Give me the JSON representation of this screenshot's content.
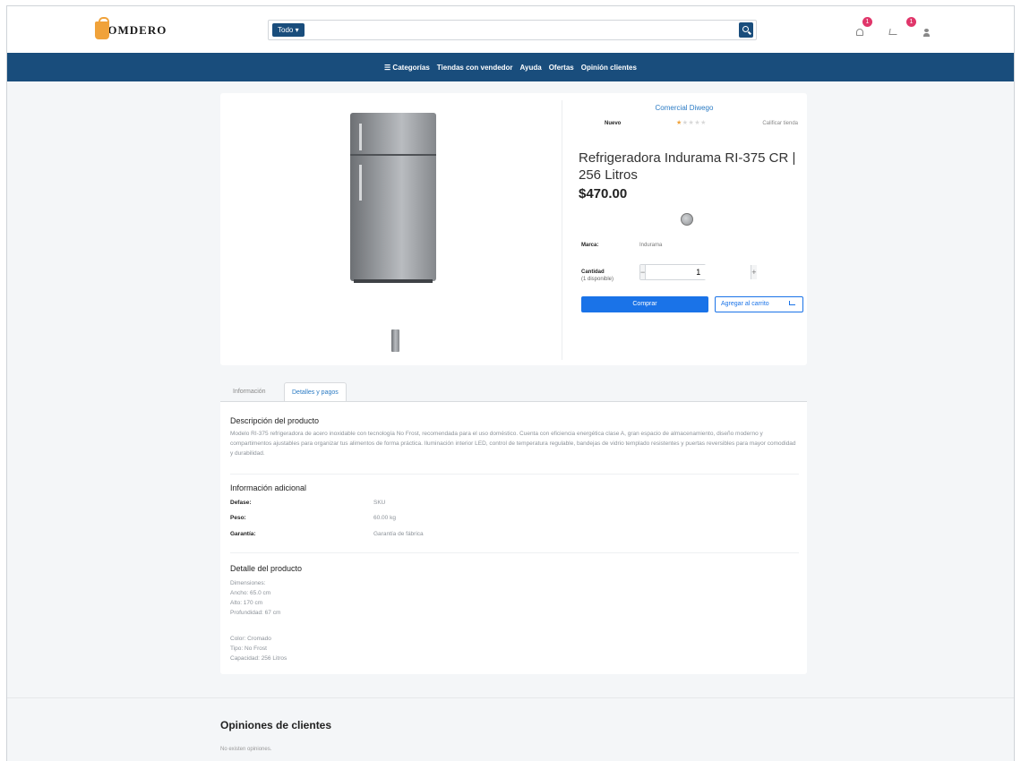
{
  "header": {
    "logo_text": "COMDERO",
    "search": {
      "category_label": "Todo ▾",
      "placeholder": ""
    },
    "notifications_count": "1",
    "cart_count": "1"
  },
  "nav": {
    "items": [
      "☰ Categorías",
      "Tiendas con vendedor",
      "Ayuda",
      "Ofertas",
      "Opinión clientes"
    ]
  },
  "product": {
    "seller": "Comercial Diwego",
    "condition": "Nuevo",
    "rating_stars": 1,
    "review_link": "Calificar tienda",
    "title": "Refrigeradora Indurama RI-375 CR | 256 Litros",
    "price": "$470.00",
    "brand_label": "Marca:",
    "brand_value": "Indurama",
    "quantity_label": "Cantidad",
    "quantity_stock": "(1 disponible)",
    "quantity_value": "1",
    "buy_label": "Comprar",
    "add_cart_label": "Agregar al carrito",
    "colors": {
      "primary": "#194d7c",
      "accent": "#1a73e8",
      "badge": "#e0366a"
    }
  },
  "tabs": [
    "Información",
    "Detalles y pagos"
  ],
  "details": {
    "description_title": "Descripción del producto",
    "description_text": "Modelo RI-375 refrigeradora de acero inoxidable con tecnología No Frost, recomendada para el uso doméstico. Cuenta con eficiencia energética clase A, gran espacio de almacenamiento, diseño moderno y compartimentos ajustables para organizar tus alimentos de forma práctica. Iluminación interior LED, control de temperatura regulable, bandejas de vidrio templado resistentes y puertas reversibles para mayor comodidad y durabilidad.",
    "info_title": "Información adicional",
    "info_rows": [
      {
        "key": "Defase:",
        "value": "SKU"
      },
      {
        "key": "Peso:",
        "value": "60.00 kg"
      },
      {
        "key": "Garantía:",
        "value": "Garantía de fábrica"
      }
    ],
    "detail_title": "Detalle del producto",
    "detail_lines_1": [
      "Dimensiones:",
      "Ancho: 65.0 cm",
      "Alto: 170 cm",
      "Profundidad: 67 cm"
    ],
    "detail_lines_2": [
      "Color: Cromado",
      "Tipo: No Frost",
      "Capacidad: 256 Litros"
    ]
  },
  "reviews": {
    "title": "Opiniones de clientes",
    "empty_text": "No existen opiniones."
  }
}
